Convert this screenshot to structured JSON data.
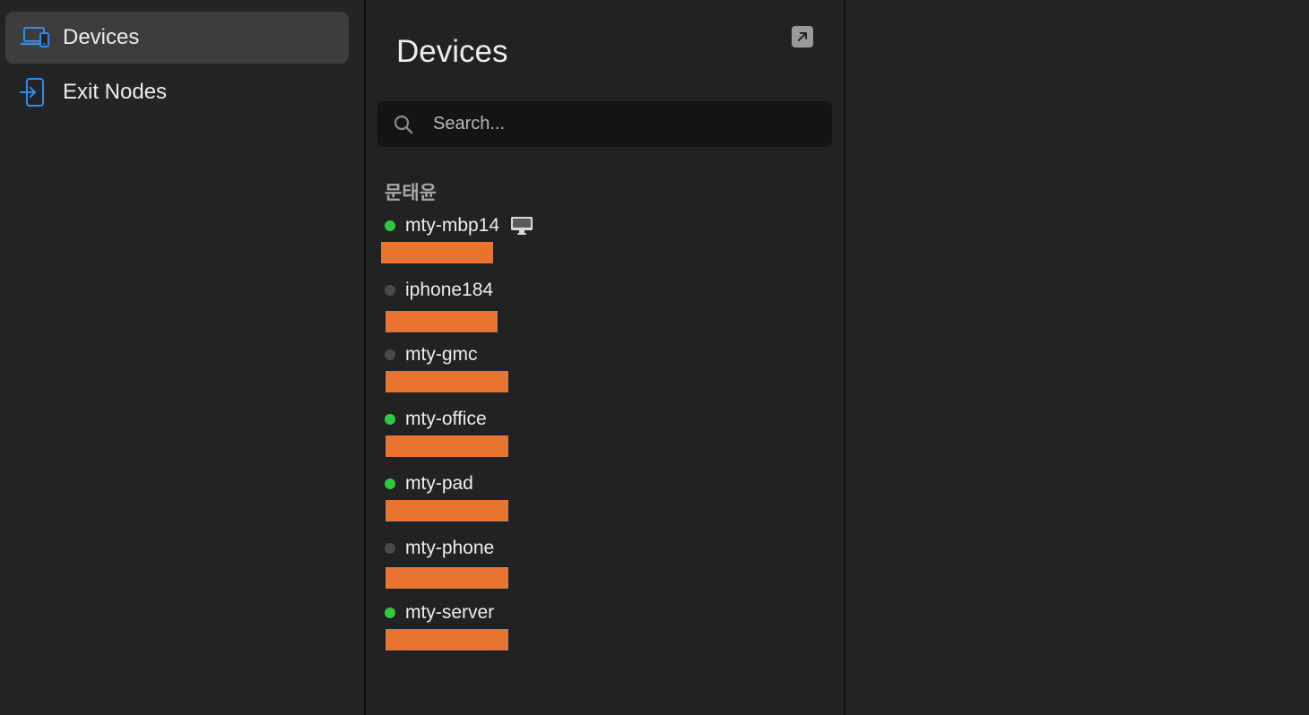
{
  "sidebar": {
    "items": [
      {
        "label": "Devices",
        "icon": "devices-icon",
        "selected": true
      },
      {
        "label": "Exit Nodes",
        "icon": "exit-nodes-icon",
        "selected": false
      }
    ]
  },
  "list": {
    "title": "Devices",
    "search_placeholder": "Search...",
    "group": "문태윤",
    "devices": [
      {
        "name": "mty-mbp14",
        "online": true,
        "os_icon": "desktop-icon"
      },
      {
        "name": "iphone184",
        "online": false
      },
      {
        "name": "mty-gmc",
        "online": false
      },
      {
        "name": "mty-office",
        "online": true
      },
      {
        "name": "mty-pad",
        "online": true
      },
      {
        "name": "mty-phone",
        "online": false
      },
      {
        "name": "mty-server",
        "online": true
      }
    ]
  },
  "colors": {
    "accent": "#2f8cf0",
    "online": "#2ec940",
    "offline": "#4a4a4a",
    "redaction": "#e9742f",
    "selected_bg": "#3d3d3d"
  }
}
